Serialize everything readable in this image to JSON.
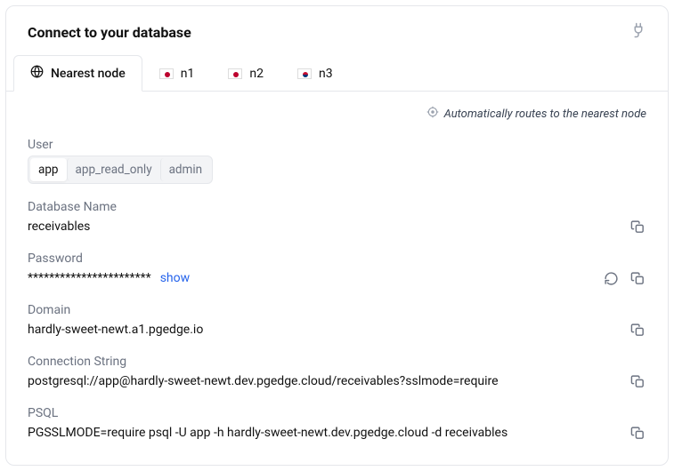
{
  "title": "Connect to your database",
  "tabs": [
    {
      "label": "Nearest node"
    },
    {
      "label": "n1"
    },
    {
      "label": "n2"
    },
    {
      "label": "n3"
    }
  ],
  "autoroute": "Automatically routes to the nearest node",
  "fields": {
    "user": {
      "label": "User",
      "options": [
        "app",
        "app_read_only",
        "admin"
      ]
    },
    "database_name": {
      "label": "Database Name",
      "value": "receivables"
    },
    "password": {
      "label": "Password",
      "masked": "***********************",
      "show_label": "show"
    },
    "domain": {
      "label": "Domain",
      "value": "hardly-sweet-newt.a1.pgedge.io"
    },
    "connection_string": {
      "label": "Connection String",
      "value": "postgresql://app@hardly-sweet-newt.dev.pgedge.cloud/receivables?sslmode=require"
    },
    "psql": {
      "label": "PSQL",
      "value": "PGSSLMODE=require psql -U app -h hardly-sweet-newt.dev.pgedge.cloud -d receivables"
    }
  }
}
